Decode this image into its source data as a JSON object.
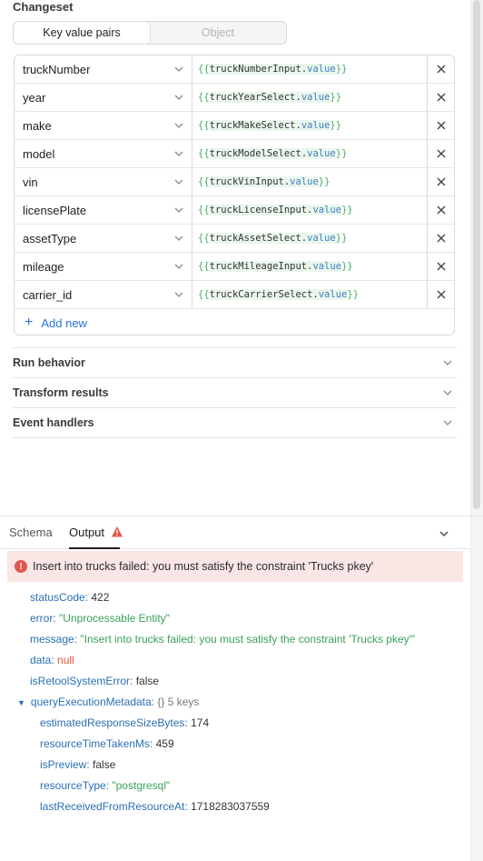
{
  "changeset": {
    "title": "Changeset",
    "mode_tabs": [
      "Key value pairs",
      "Object"
    ],
    "active_mode": 0,
    "rows": [
      {
        "key": "truckNumber",
        "ident": "truckNumberInput",
        "prop": "value",
        "compact": false
      },
      {
        "key": "year",
        "ident": "truckYearSelect",
        "prop": "value",
        "compact": false
      },
      {
        "key": "make",
        "ident": "truckMakeSelect",
        "prop": "value",
        "compact": false
      },
      {
        "key": "model",
        "ident": "truckModelSelect",
        "prop": "value",
        "compact": false
      },
      {
        "key": "vin",
        "ident": "truckVinInput",
        "prop": "value",
        "compact": false
      },
      {
        "key": "licensePlate",
        "ident": "truckLicenseInput",
        "prop": "value",
        "compact": false
      },
      {
        "key": "assetType",
        "ident": "truckAssetSelect",
        "prop": "value",
        "compact": false
      },
      {
        "key": "mileage",
        "ident": "truckMileageInput",
        "prop": "value",
        "compact": false
      },
      {
        "key": "carrier_id",
        "ident": "truckCarrierSelect",
        "prop": "value",
        "compact": true
      }
    ],
    "add_new_label": "Add new"
  },
  "accordions": [
    "Run behavior",
    "Transform results",
    "Event handlers"
  ],
  "output": {
    "tabs": [
      "Schema",
      "Output"
    ],
    "active_tab": 1,
    "error_banner": "Insert into trucks failed: you must satisfy the constraint 'Trucks pkey'",
    "fields": [
      {
        "key": "statusCode",
        "value": "422",
        "type": "num",
        "indent": 0
      },
      {
        "key": "error",
        "value": "\"Unprocessable Entity\"",
        "type": "str",
        "indent": 0
      },
      {
        "key": "message",
        "value": "\"Insert into trucks failed: you must satisfy the constraint 'Trucks pkey'\"",
        "type": "str",
        "indent": 0
      },
      {
        "key": "data",
        "value": "null",
        "type": "nul",
        "indent": 0
      },
      {
        "key": "isRetoolSystemError",
        "value": "false",
        "type": "bool",
        "indent": 0
      },
      {
        "key": "queryExecutionMetadata",
        "value": "{}  5 keys",
        "type": "meta",
        "indent": 0,
        "expanded": true
      },
      {
        "key": "estimatedResponseSizeBytes",
        "value": "174",
        "type": "num",
        "indent": 1
      },
      {
        "key": "resourceTimeTakenMs",
        "value": "459",
        "type": "num",
        "indent": 1
      },
      {
        "key": "isPreview",
        "value": "false",
        "type": "bool",
        "indent": 1
      },
      {
        "key": "resourceType",
        "value": "\"postgresql\"",
        "type": "str",
        "indent": 1
      },
      {
        "key": "lastReceivedFromResourceAt",
        "value": "1718283037559",
        "type": "num",
        "indent": 1
      }
    ]
  },
  "colors": {
    "accent": "#2b73d8",
    "error_bg": "#fbe6e6",
    "error_icon": "#e2574c",
    "key_blue": "#2a6fb3",
    "string_green": "#3aa15a",
    "null_red": "#e5533c"
  },
  "icons": {
    "dropdown": "chevron-down-icon",
    "delete": "close-icon",
    "add": "plus-icon",
    "warning": "warning-icon",
    "error": "error-circle-icon",
    "expand": "caret-down-icon"
  }
}
